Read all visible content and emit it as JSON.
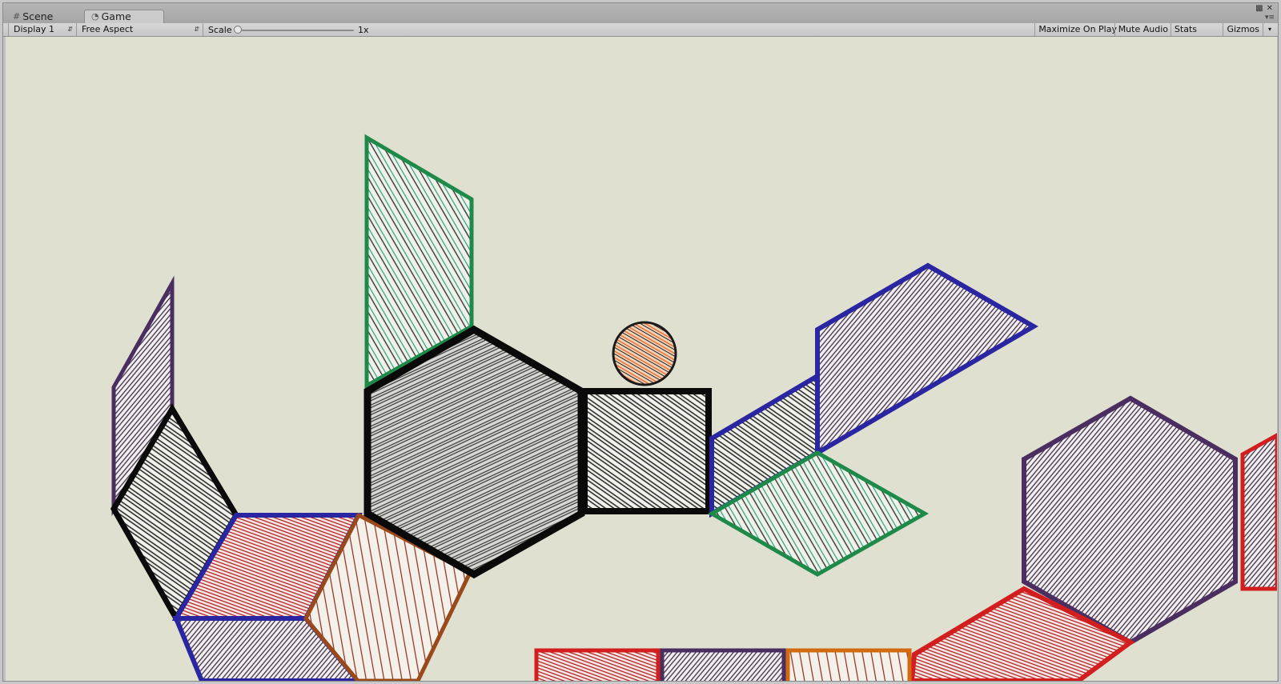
{
  "tabs": [
    {
      "label": "Scene",
      "icon": "grid-icon",
      "active": false
    },
    {
      "label": "Game",
      "icon": "pacman-icon",
      "active": true
    }
  ],
  "toolbar": {
    "display": "Display 1",
    "aspect": "Free Aspect",
    "scale_label": "Scale",
    "scale_value": "1x",
    "maximize_on_play": "Maximize On Play",
    "mute_audio": "Mute Audio",
    "stats": "Stats",
    "gizmos": "Gizmos"
  },
  "game": {
    "background": "#e0e0d0",
    "border_colors": {
      "black": "#0a0a0a",
      "green": "#1e8a4a",
      "blue": "#2a25a0",
      "purple": "#4a2e60",
      "orange": "#9a4a1a",
      "red": "#d21e1e"
    },
    "ball": {
      "name": "ball-player",
      "fill": "#e8865a"
    }
  }
}
